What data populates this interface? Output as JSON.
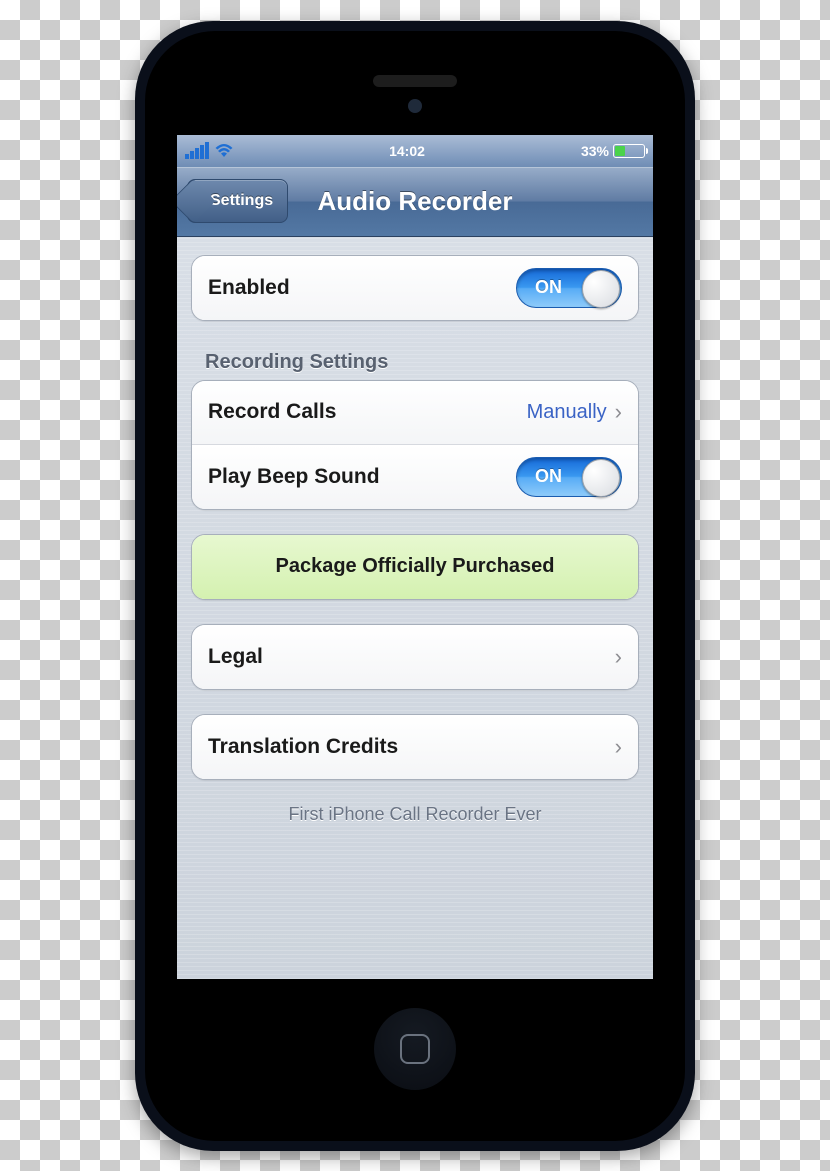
{
  "status_bar": {
    "time": "14:02",
    "battery_percent": "33%"
  },
  "nav": {
    "back_label": "Settings",
    "title": "Audio Recorder"
  },
  "groups": {
    "enabled_label": "Enabled",
    "enabled_toggle": "ON",
    "recording_header": "Recording Settings",
    "record_calls_label": "Record Calls",
    "record_calls_value": "Manually",
    "beep_label": "Play Beep Sound",
    "beep_toggle": "ON",
    "purchased_label": "Package Officially Purchased",
    "legal_label": "Legal",
    "credits_label": "Translation Credits"
  },
  "footer": "First iPhone Call Recorder Ever"
}
